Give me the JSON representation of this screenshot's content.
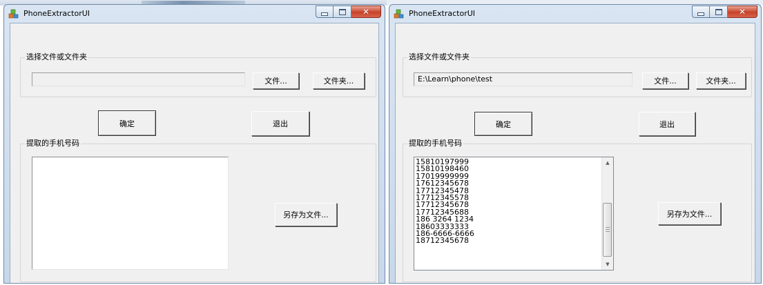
{
  "windows": [
    {
      "title": "PhoneExtractorUI",
      "select_group_label": "选择文件或文件夹",
      "path_value": "",
      "file_button": "文件...",
      "folder_button": "文件夹...",
      "ok_button": "确定",
      "exit_button": "退出",
      "result_group_label": "提取的手机号码",
      "results": [],
      "save_button": "另存为文件..."
    },
    {
      "title": "PhoneExtractorUI",
      "select_group_label": "选择文件或文件夹",
      "path_value": "E:\\Learn\\phone\\test",
      "file_button": "文件...",
      "folder_button": "文件夹...",
      "ok_button": "确定",
      "exit_button": "退出",
      "result_group_label": "提取的手机号码",
      "results": [
        "15810197999",
        "15810198460",
        "17019999999",
        "17612345678",
        "17712345478",
        "17712345578",
        "17712345678",
        "17712345688",
        "186 3264 1234",
        "18603333333",
        "186-6666-6666",
        "18712345678"
      ],
      "save_button": "另存为文件..."
    }
  ],
  "window_controls": {
    "minimize_icon": "minimize-icon",
    "maximize_icon": "maximize-icon",
    "close_icon": "close-icon"
  },
  "colors": {
    "titlebar": "#c7d8ea",
    "client": "#f0f0f0",
    "close": "#c7432a"
  }
}
